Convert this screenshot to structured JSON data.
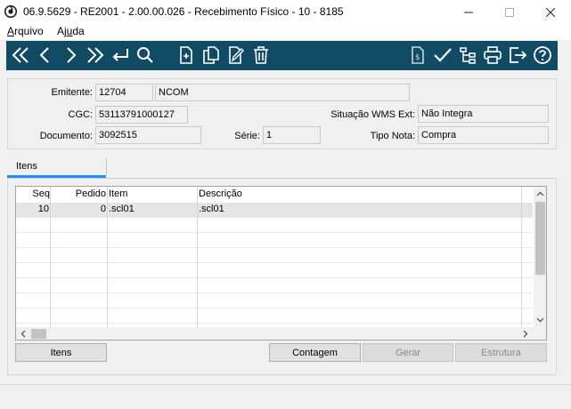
{
  "window": {
    "title": "06.9.5629 - RE2001 - 2.00.00.026 - Recebimento Físico - 10 - 8185"
  },
  "menu": {
    "items": [
      {
        "label_u": "A",
        "label_rest": "rquivo"
      },
      {
        "label_pre": "Aj",
        "label_u": "u",
        "label_rest": "da"
      }
    ]
  },
  "toolbar": {
    "icons": [
      "first-icon",
      "prev-icon",
      "next-icon",
      "last-icon",
      "goto-icon",
      "search-icon",
      "new-icon",
      "copy-icon",
      "edit-icon",
      "delete-icon",
      "report-icon",
      "check-icon",
      "tree-icon",
      "print-icon",
      "exit-icon",
      "help-icon"
    ],
    "bg_color": "#104a63"
  },
  "header": {
    "emitente_label": "Emitente:",
    "emitente_code": "12704",
    "emitente_name": "NCOM",
    "cgc_label": "CGC:",
    "cgc_value": "53113791000127",
    "situacao_label": "Situação WMS Ext:",
    "situacao_value": "Não Integra",
    "documento_label": "Documento:",
    "documento_value": "3092515",
    "serie_label": "Série:",
    "serie_value": "1",
    "tipo_nota_label": "Tipo Nota:",
    "tipo_nota_value": "Compra"
  },
  "tabs": [
    {
      "label": "Itens",
      "active": true
    }
  ],
  "grid": {
    "columns": [
      "Seq",
      "Pedido",
      "Item",
      "Descrição"
    ],
    "rows": [
      {
        "seq": "10",
        "pedido": "0",
        "item": ".scl01",
        "descricao": ".scl01"
      }
    ]
  },
  "buttons": {
    "itens": "Itens",
    "contagem": "Contagem",
    "gerar": "Gerar",
    "estrutura": "Estrutura"
  }
}
